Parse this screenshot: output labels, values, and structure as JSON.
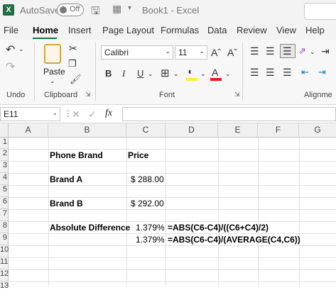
{
  "titlebar": {
    "autosave_label": "AutoSave",
    "toggle_label": "Off",
    "doc_title": "Book1 - Excel"
  },
  "tabs": [
    "File",
    "Home",
    "Insert",
    "Page Layout",
    "Formulas",
    "Data",
    "Review",
    "View",
    "Help"
  ],
  "ribbon": {
    "undo_label": "Undo",
    "clipboard_label": "Clipboard",
    "paste_label": "Paste",
    "font_label": "Font",
    "alignment_label": "Alignme",
    "font_name": "Calibri",
    "font_size": "11",
    "bold": "B",
    "italic": "I",
    "underline": "U",
    "grow_font": "Aˆ",
    "shrink_font": "Aˇ",
    "font_color": "A"
  },
  "formula_bar": {
    "name_box": "E11",
    "fx": "fx",
    "cancel": "✕",
    "enter": "✓",
    "value": ""
  },
  "columns": [
    "A",
    "B",
    "C",
    "D",
    "E",
    "F",
    "G"
  ],
  "rows": [
    "1",
    "2",
    "3",
    "4",
    "5",
    "6",
    "7",
    "8",
    "9",
    "10",
    "11",
    "12",
    "13"
  ],
  "cells": {
    "b2": "Phone Brand",
    "c2": "Price",
    "b4": "Brand A",
    "c4": "$ 288.00",
    "b6": "Brand B",
    "c6": "$ 292.00",
    "b8": "Absolute Difference",
    "c8": "1.379%",
    "d8": "=ABS(C6-C4)/((C6+C4)/2)",
    "c9": "1.379%",
    "d9": "=ABS(C6-C4)/(AVERAGE(C4,C6))"
  },
  "colors": {
    "accent": "#1d6f42",
    "ribbon_bg": "#f7f7f7",
    "header_bg": "#f0f0f0"
  }
}
